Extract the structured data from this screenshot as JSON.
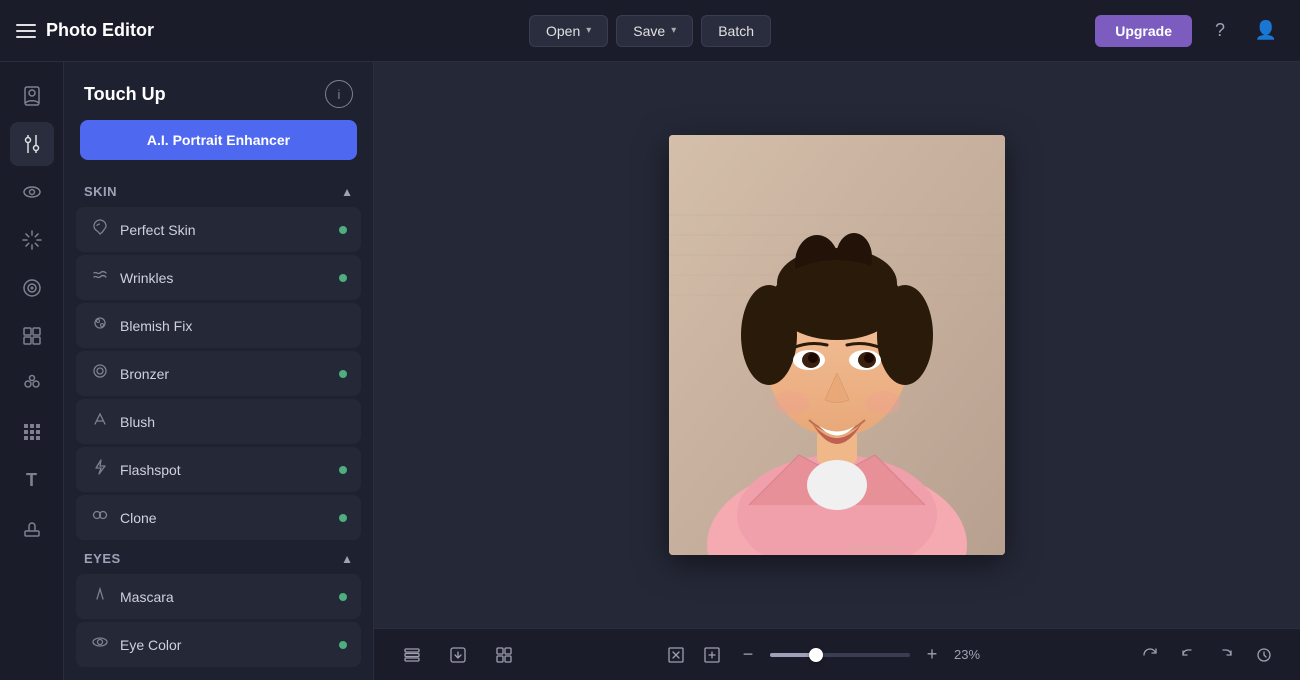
{
  "app": {
    "title": "Photo Editor"
  },
  "topbar": {
    "open_label": "Open",
    "save_label": "Save",
    "batch_label": "Batch",
    "upgrade_label": "Upgrade"
  },
  "tool_panel": {
    "title": "Touch Up",
    "ai_button_label": "A.I. Portrait Enhancer",
    "info_icon": "ⓘ",
    "sections": [
      {
        "id": "skin",
        "label": "Skin",
        "expanded": true,
        "items": [
          {
            "id": "perfect-skin",
            "label": "Perfect Skin",
            "icon": "✦",
            "dot": true
          },
          {
            "id": "wrinkles",
            "label": "Wrinkles",
            "icon": "≋",
            "dot": true
          },
          {
            "id": "blemish-fix",
            "label": "Blemish Fix",
            "icon": "✦",
            "dot": false
          },
          {
            "id": "bronzer",
            "label": "Bronzer",
            "icon": "⊙",
            "dot": true
          },
          {
            "id": "blush",
            "label": "Blush",
            "icon": "✏",
            "dot": false
          },
          {
            "id": "flashspot",
            "label": "Flashspot",
            "icon": "⚡",
            "dot": true
          },
          {
            "id": "clone",
            "label": "Clone",
            "icon": "⊕",
            "dot": true
          }
        ]
      },
      {
        "id": "eyes",
        "label": "Eyes",
        "expanded": true,
        "items": [
          {
            "id": "mascara",
            "label": "Mascara",
            "icon": "✏",
            "dot": true
          },
          {
            "id": "eye-color",
            "label": "Eye Color",
            "icon": "⊙",
            "dot": true
          }
        ]
      }
    ]
  },
  "canvas": {
    "zoom_level": "23%"
  },
  "bottom_bar": {
    "zoom_minus": "−",
    "zoom_plus": "+",
    "zoom_value": "23%"
  },
  "sidebar_icons": [
    {
      "id": "portrait",
      "icon": "👤",
      "label": "Portrait"
    },
    {
      "id": "adjustments",
      "icon": "⚙",
      "label": "Adjustments"
    },
    {
      "id": "eye",
      "icon": "👁",
      "label": "Eye"
    },
    {
      "id": "sparkle",
      "icon": "✦",
      "label": "Sparkle"
    },
    {
      "id": "target",
      "icon": "◎",
      "label": "Target"
    },
    {
      "id": "grid",
      "icon": "▦",
      "label": "Grid"
    },
    {
      "id": "group",
      "icon": "⊞",
      "label": "Group"
    },
    {
      "id": "mosaic",
      "icon": "▩",
      "label": "Mosaic"
    },
    {
      "id": "text",
      "icon": "T",
      "label": "Text"
    },
    {
      "id": "stamp",
      "icon": "✒",
      "label": "Stamp"
    }
  ]
}
